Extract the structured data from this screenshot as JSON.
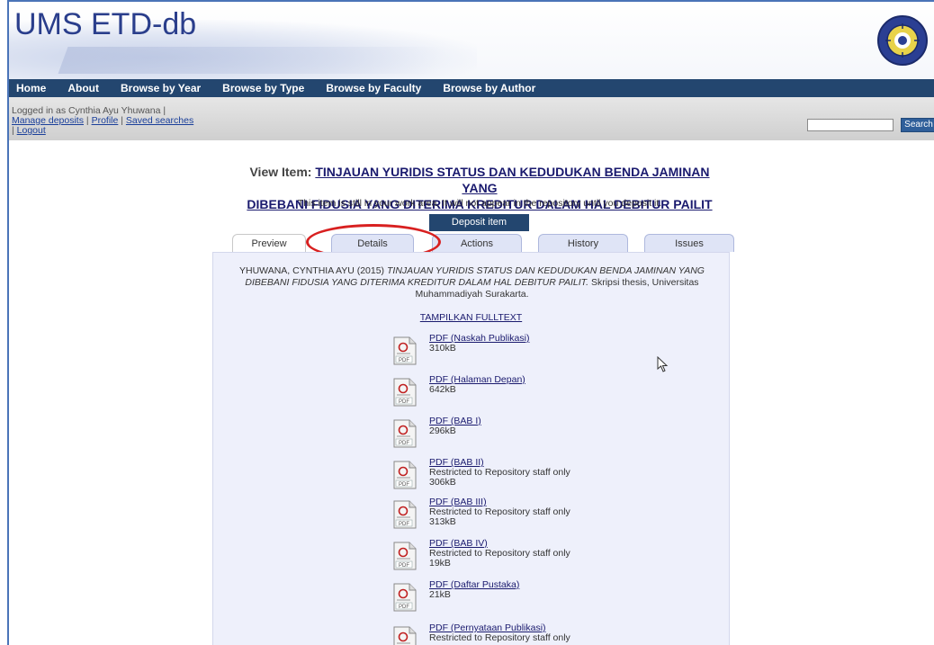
{
  "banner": {
    "title": "UMS ETD-db"
  },
  "nav": [
    "Home",
    "About",
    "Browse by Year",
    "Browse by Type",
    "Browse by Faculty",
    "Browse by Author"
  ],
  "user": {
    "logged_in_as": "Logged in as Cynthia Ayu Yhuwana |",
    "manage_deposits": "Manage deposits",
    "profile": "Profile",
    "saved_searches": "Saved searches",
    "logout": "Logout",
    "sep": "|"
  },
  "search": {
    "button_label": "Search",
    "placeholder": ""
  },
  "item": {
    "view_label": "View Item:",
    "title_line1": "TINJAUAN YURIDIS STATUS DAN KEDUDUKAN BENDA JAMINAN YANG",
    "title_line2": "DIBEBANI FIDUSIA YANG DITERIMA KREDITUR DALAM HAL DEBITUR PAILIT",
    "workarea_note": "This item is still in your work area. It will not appear in the repository until you deposit it.",
    "deposit_button": "Deposit item"
  },
  "tabs": [
    "Preview",
    "Details",
    "Actions",
    "History",
    "Issues"
  ],
  "active_tab": "Preview",
  "citation": {
    "author_year": "YHUWANA, CYNTHIA AYU (2015)",
    "title_italic": "TINJAUAN YURIDIS STATUS DAN KEDUDUKAN BENDA JAMINAN YANG DIBEBANI FIDUSIA YANG DITERIMA KREDITUR DALAM HAL DEBITUR PAILIT.",
    "rest": "Skripsi thesis, Universitas Muhammadiyah Surakarta."
  },
  "fulltext_link": "TAMPILKAN FULLTEXT",
  "documents": [
    {
      "name": "PDF (Naskah Publikasi)",
      "restricted": "",
      "size": "310kB"
    },
    {
      "name": "PDF (Halaman Depan)",
      "restricted": "",
      "size": "642kB"
    },
    {
      "name": "PDF (BAB I)",
      "restricted": "",
      "size": "296kB"
    },
    {
      "name": "PDF (BAB II)",
      "restricted": "Restricted to Repository staff only",
      "size": "306kB"
    },
    {
      "name": "PDF (BAB III)",
      "restricted": "Restricted to Repository staff only",
      "size": "313kB"
    },
    {
      "name": "PDF (BAB IV)",
      "restricted": "Restricted to Repository staff only",
      "size": "19kB"
    },
    {
      "name": "PDF (Daftar Pustaka)",
      "restricted": "",
      "size": "21kB"
    },
    {
      "name": "PDF (Pernyataan Publikasi)",
      "restricted": "Restricted to Repository staff only",
      "size": ""
    }
  ],
  "pdf_icon_label": "PDF",
  "colors": {
    "nav_bg": "#23466f",
    "title_blue": "#2a3e8c",
    "highlight_ring": "#d82020"
  }
}
